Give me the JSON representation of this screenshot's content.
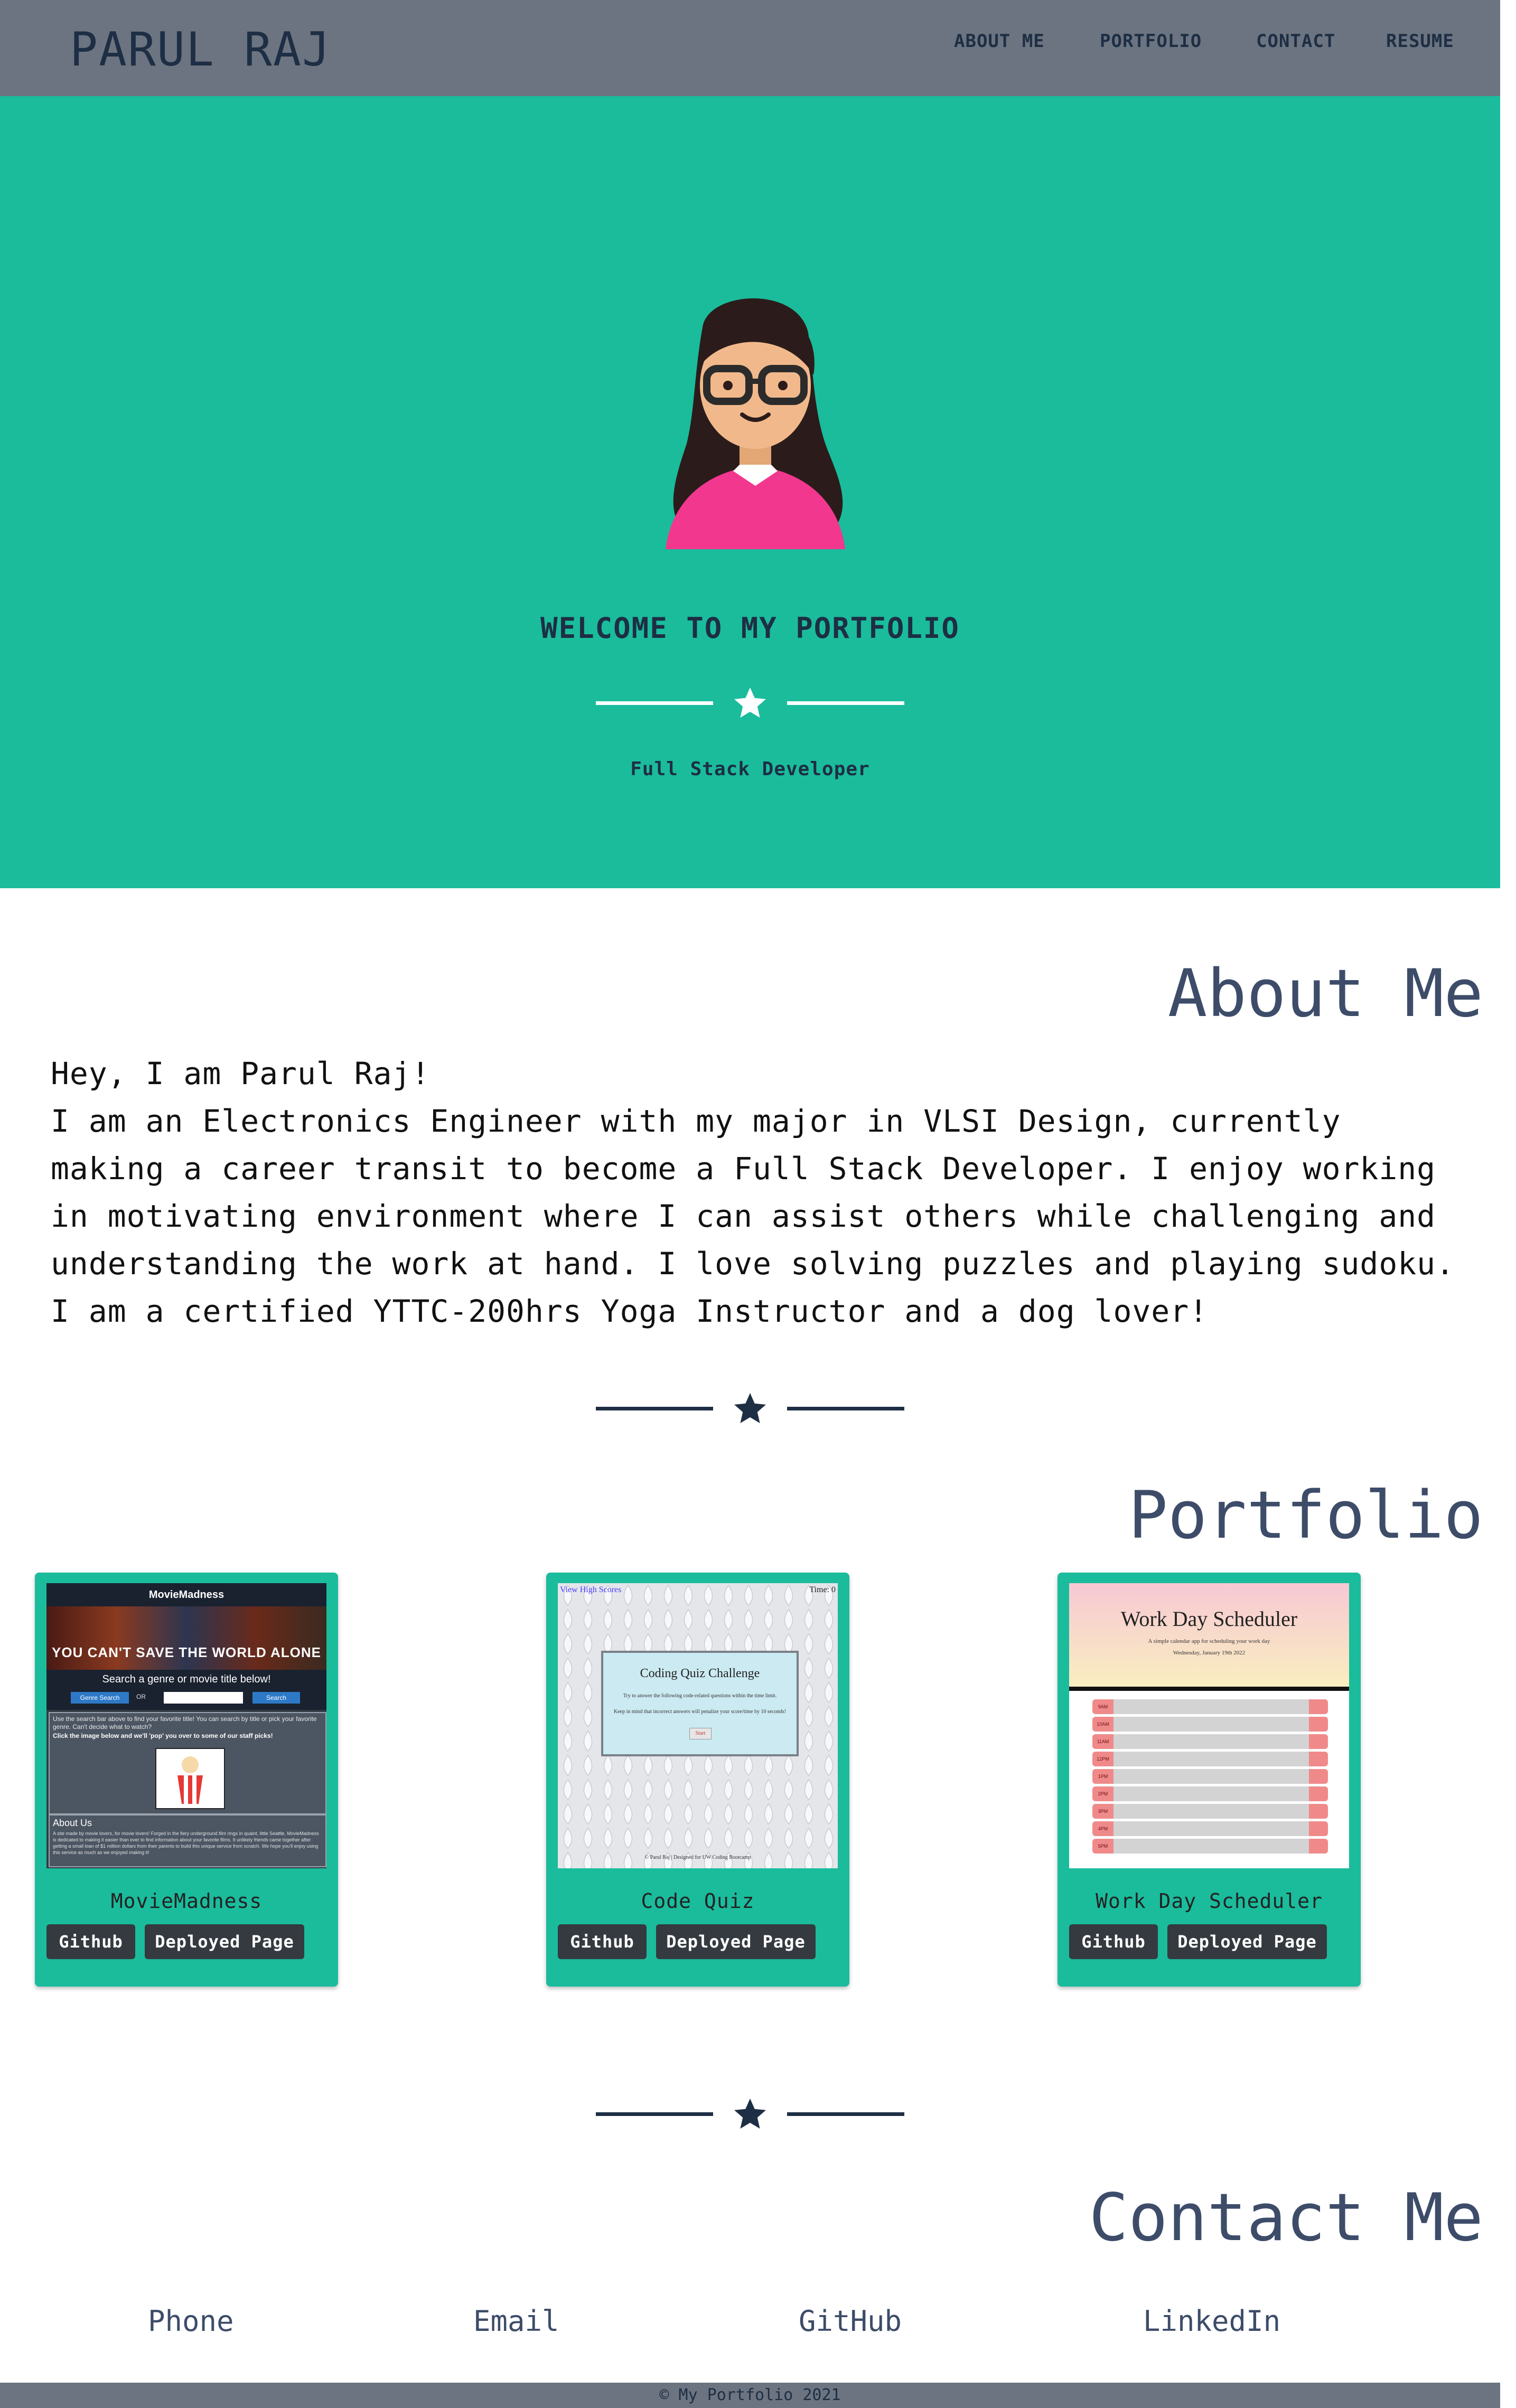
{
  "header": {
    "brand": "PARUL RAJ",
    "nav": [
      "ABOUT ME",
      "PORTFOLIO",
      "CONTACT",
      "RESUME"
    ]
  },
  "hero": {
    "title": "WELCOME TO MY PORTFOLIO",
    "subtitle": "Full Stack Developer"
  },
  "about": {
    "heading": "About Me",
    "greeting": "Hey, I am Parul Raj!",
    "text": "I am an Electronics Engineer with my major in VLSI Design, currently making a career transit to become a Full Stack Developer. I enjoy working in motivating environment where I can assist others while challenging and understanding the work at hand. I love solving puzzles and playing sudoku. I am a certified YTTC-200hrs Yoga Instructor and a dog lover!"
  },
  "portfolio": {
    "heading": "Portfolio",
    "projects": [
      {
        "title": "MovieMadness",
        "github_label": "Github",
        "deployed_label": "Deployed Page",
        "preview": {
          "app_title": "MovieMadness",
          "banner_text": "YOU CAN'T SAVE THE WORLD ALONE",
          "search_prompt": "Search a genre or movie title below!",
          "genre_button": "Genre Search",
          "or_text": "OR",
          "search_button": "Search",
          "info_text": "Use the search bar above to find your favorite title! You can search by title or pick your favorite genre. Can't decide what to watch?",
          "cta_text": "Click the image below and we'll 'pop' you over to some of our staff picks!",
          "about_heading": "About Us",
          "about_text": "A site made by movie lovers, for movie lovers! Forged in the fiery underground film rings in quaint, little Seattle, MovieMadness is dedicated to making it easier than ever to find information about your favorite films. It unlikely friends came together after getting a small loan of $1 million dollars from their parents to build this unique service from scratch. We hope you'll enjoy using this service as much as we enjoyed making it!"
        }
      },
      {
        "title": "Code Quiz",
        "github_label": "Github",
        "deployed_label": "Deployed Page",
        "preview": {
          "view_scores": "View High Scores",
          "time": "Time: 0",
          "quiz_title": "Coding Quiz Challenge",
          "quiz_text": "Try to answer the following code-related questions within the time limit.",
          "quiz_text2": "Keep in mind that incorrect answers will penalize your score/time by 10 seconds!",
          "start_label": "Start",
          "footer_text": "© Parul Raj | Designed for UW Coding Bootcamp"
        }
      },
      {
        "title": "Work Day Scheduler",
        "github_label": "Github",
        "deployed_label": "Deployed Page",
        "preview": {
          "app_title": "Work Day Scheduler",
          "tagline": "A simple calendar app for scheduling your work day",
          "date": "Wednesday, January 19th 2022",
          "hours": [
            "9AM",
            "10AM",
            "11AM",
            "12PM",
            "1PM",
            "2PM",
            "3PM",
            "4PM",
            "5PM"
          ]
        }
      }
    ]
  },
  "contact": {
    "heading": "Contact Me",
    "links": [
      "Phone",
      "Email",
      "GitHub",
      "LinkedIn"
    ]
  },
  "footer": {
    "text": "© My Portfolio 2021"
  },
  "colors": {
    "header_bg": "#6b7480",
    "hero_bg": "#1abc9c",
    "navy": "#1e2e44",
    "heading": "#3d4c69",
    "button_bg": "#343a40"
  }
}
